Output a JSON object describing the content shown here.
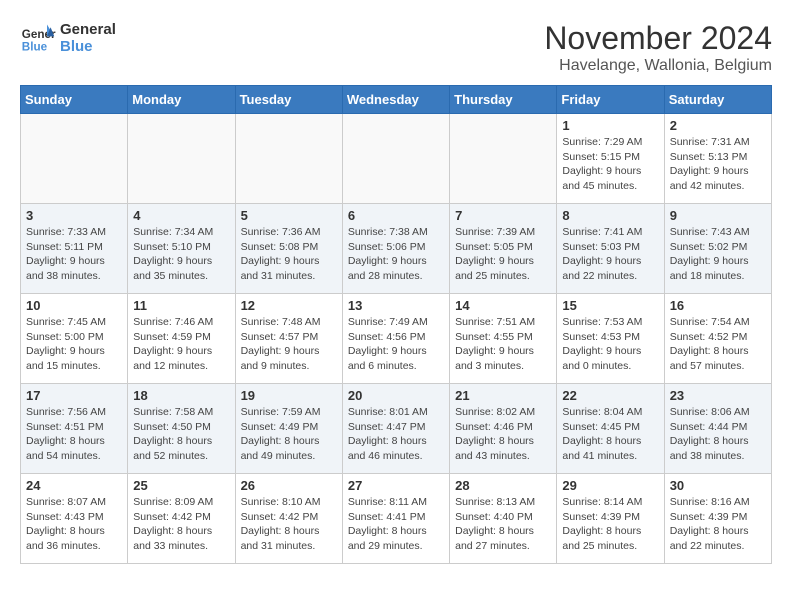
{
  "header": {
    "logo_line1": "General",
    "logo_line2": "Blue",
    "month_title": "November 2024",
    "subtitle": "Havelange, Wallonia, Belgium"
  },
  "days_of_week": [
    "Sunday",
    "Monday",
    "Tuesday",
    "Wednesday",
    "Thursday",
    "Friday",
    "Saturday"
  ],
  "weeks": [
    {
      "days": [
        {
          "num": "",
          "info": "",
          "empty": true
        },
        {
          "num": "",
          "info": "",
          "empty": true
        },
        {
          "num": "",
          "info": "",
          "empty": true
        },
        {
          "num": "",
          "info": "",
          "empty": true
        },
        {
          "num": "",
          "info": "",
          "empty": true
        },
        {
          "num": "1",
          "info": "Sunrise: 7:29 AM\nSunset: 5:15 PM\nDaylight: 9 hours\nand 45 minutes."
        },
        {
          "num": "2",
          "info": "Sunrise: 7:31 AM\nSunset: 5:13 PM\nDaylight: 9 hours\nand 42 minutes."
        }
      ]
    },
    {
      "days": [
        {
          "num": "3",
          "info": "Sunrise: 7:33 AM\nSunset: 5:11 PM\nDaylight: 9 hours\nand 38 minutes."
        },
        {
          "num": "4",
          "info": "Sunrise: 7:34 AM\nSunset: 5:10 PM\nDaylight: 9 hours\nand 35 minutes."
        },
        {
          "num": "5",
          "info": "Sunrise: 7:36 AM\nSunset: 5:08 PM\nDaylight: 9 hours\nand 31 minutes."
        },
        {
          "num": "6",
          "info": "Sunrise: 7:38 AM\nSunset: 5:06 PM\nDaylight: 9 hours\nand 28 minutes."
        },
        {
          "num": "7",
          "info": "Sunrise: 7:39 AM\nSunset: 5:05 PM\nDaylight: 9 hours\nand 25 minutes."
        },
        {
          "num": "8",
          "info": "Sunrise: 7:41 AM\nSunset: 5:03 PM\nDaylight: 9 hours\nand 22 minutes."
        },
        {
          "num": "9",
          "info": "Sunrise: 7:43 AM\nSunset: 5:02 PM\nDaylight: 9 hours\nand 18 minutes."
        }
      ]
    },
    {
      "days": [
        {
          "num": "10",
          "info": "Sunrise: 7:45 AM\nSunset: 5:00 PM\nDaylight: 9 hours\nand 15 minutes."
        },
        {
          "num": "11",
          "info": "Sunrise: 7:46 AM\nSunset: 4:59 PM\nDaylight: 9 hours\nand 12 minutes."
        },
        {
          "num": "12",
          "info": "Sunrise: 7:48 AM\nSunset: 4:57 PM\nDaylight: 9 hours\nand 9 minutes."
        },
        {
          "num": "13",
          "info": "Sunrise: 7:49 AM\nSunset: 4:56 PM\nDaylight: 9 hours\nand 6 minutes."
        },
        {
          "num": "14",
          "info": "Sunrise: 7:51 AM\nSunset: 4:55 PM\nDaylight: 9 hours\nand 3 minutes."
        },
        {
          "num": "15",
          "info": "Sunrise: 7:53 AM\nSunset: 4:53 PM\nDaylight: 9 hours\nand 0 minutes."
        },
        {
          "num": "16",
          "info": "Sunrise: 7:54 AM\nSunset: 4:52 PM\nDaylight: 8 hours\nand 57 minutes."
        }
      ]
    },
    {
      "days": [
        {
          "num": "17",
          "info": "Sunrise: 7:56 AM\nSunset: 4:51 PM\nDaylight: 8 hours\nand 54 minutes."
        },
        {
          "num": "18",
          "info": "Sunrise: 7:58 AM\nSunset: 4:50 PM\nDaylight: 8 hours\nand 52 minutes."
        },
        {
          "num": "19",
          "info": "Sunrise: 7:59 AM\nSunset: 4:49 PM\nDaylight: 8 hours\nand 49 minutes."
        },
        {
          "num": "20",
          "info": "Sunrise: 8:01 AM\nSunset: 4:47 PM\nDaylight: 8 hours\nand 46 minutes."
        },
        {
          "num": "21",
          "info": "Sunrise: 8:02 AM\nSunset: 4:46 PM\nDaylight: 8 hours\nand 43 minutes."
        },
        {
          "num": "22",
          "info": "Sunrise: 8:04 AM\nSunset: 4:45 PM\nDaylight: 8 hours\nand 41 minutes."
        },
        {
          "num": "23",
          "info": "Sunrise: 8:06 AM\nSunset: 4:44 PM\nDaylight: 8 hours\nand 38 minutes."
        }
      ]
    },
    {
      "days": [
        {
          "num": "24",
          "info": "Sunrise: 8:07 AM\nSunset: 4:43 PM\nDaylight: 8 hours\nand 36 minutes."
        },
        {
          "num": "25",
          "info": "Sunrise: 8:09 AM\nSunset: 4:42 PM\nDaylight: 8 hours\nand 33 minutes."
        },
        {
          "num": "26",
          "info": "Sunrise: 8:10 AM\nSunset: 4:42 PM\nDaylight: 8 hours\nand 31 minutes."
        },
        {
          "num": "27",
          "info": "Sunrise: 8:11 AM\nSunset: 4:41 PM\nDaylight: 8 hours\nand 29 minutes."
        },
        {
          "num": "28",
          "info": "Sunrise: 8:13 AM\nSunset: 4:40 PM\nDaylight: 8 hours\nand 27 minutes."
        },
        {
          "num": "29",
          "info": "Sunrise: 8:14 AM\nSunset: 4:39 PM\nDaylight: 8 hours\nand 25 minutes."
        },
        {
          "num": "30",
          "info": "Sunrise: 8:16 AM\nSunset: 4:39 PM\nDaylight: 8 hours\nand 22 minutes."
        }
      ]
    }
  ]
}
